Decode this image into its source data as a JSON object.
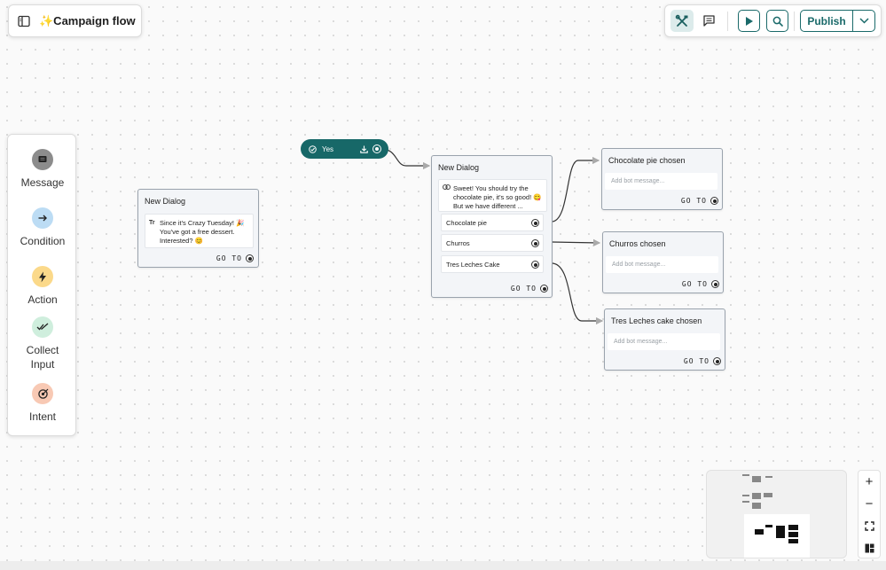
{
  "header": {
    "title": "✨Campaign flow"
  },
  "toolbar": {
    "publish_label": "Publish"
  },
  "palette": {
    "items": [
      {
        "label": "Message"
      },
      {
        "label": "Condition"
      },
      {
        "label": "Action"
      },
      {
        "label": "Collect Input"
      },
      {
        "label": "Intent"
      }
    ]
  },
  "nodes": {
    "dialog1": {
      "title": "New Dialog",
      "message": "Since it's Crazy Tuesday! 🎉 You've got a free dessert. Interested? 😊",
      "goto": "GO TO"
    },
    "yes_pill": {
      "label": "Yes"
    },
    "dialog2": {
      "title": "New Dialog",
      "message": "Sweet! You should try the chocolate pie, it's so good! 😋But we have different ...",
      "choices": [
        {
          "label": "Chocolate pie"
        },
        {
          "label": "Churros"
        },
        {
          "label": "Tres Leches Cake"
        }
      ],
      "goto": "GO TO"
    },
    "chosen": [
      {
        "title": "Chocolate pie chosen",
        "placeholder": "Add bot message...",
        "goto": "GO TO"
      },
      {
        "title": "Churros chosen",
        "placeholder": "Add bot message...",
        "goto": "GO TO"
      },
      {
        "title": "Tres Leches cake chosen",
        "placeholder": "Add bot message...",
        "goto": "GO TO"
      }
    ]
  },
  "zoom": {
    "plus": "+",
    "minus": "−"
  },
  "colors": {
    "accent": "#176868",
    "message_icon": "#8c8c8c",
    "condition_icon": "#bcdcf4",
    "action_icon": "#fbd98a",
    "collect_icon": "#cfeedd",
    "intent_icon": "#f8c9b4"
  }
}
